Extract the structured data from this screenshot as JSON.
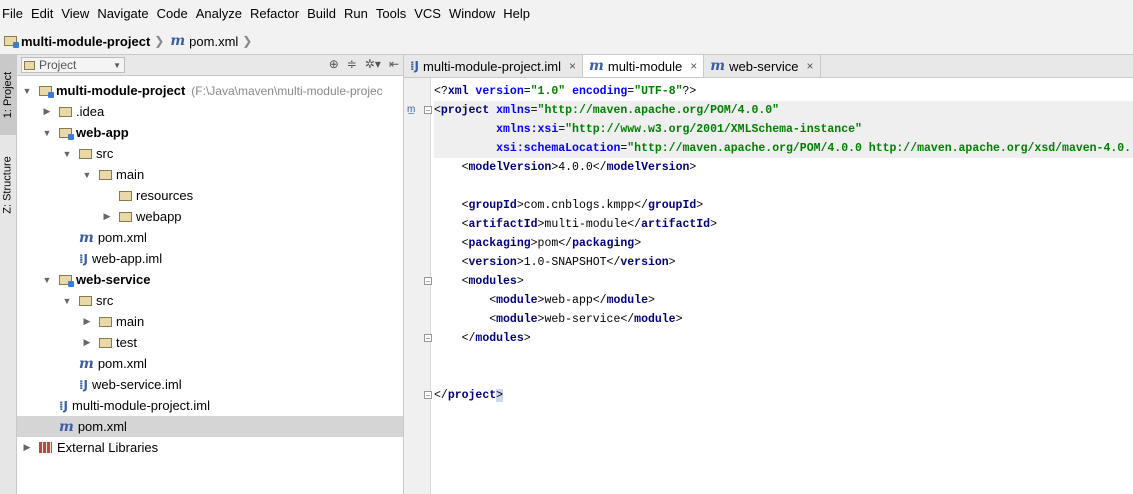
{
  "menubar": [
    "File",
    "Edit",
    "View",
    "Navigate",
    "Code",
    "Analyze",
    "Refactor",
    "Build",
    "Run",
    "Tools",
    "VCS",
    "Window",
    "Help"
  ],
  "breadcrumb": {
    "project": "multi-module-project",
    "file": "pom.xml"
  },
  "left_tool_tabs": {
    "project": "1: Project",
    "structure": "Z: Structure"
  },
  "project_panel": {
    "view_mode": "Project"
  },
  "tree": [
    {
      "label": "multi-module-project",
      "path": "(F:\\Java\\maven\\multi-module-projec",
      "indent": 0,
      "arrow": "▼",
      "icon": "proj-folder",
      "bold": true
    },
    {
      "label": ".idea",
      "indent": 1,
      "arrow": "▶",
      "icon": "folder"
    },
    {
      "label": "web-app",
      "indent": 1,
      "arrow": "▼",
      "icon": "proj-folder",
      "bold": true
    },
    {
      "label": "src",
      "indent": 2,
      "arrow": "▼",
      "icon": "folder"
    },
    {
      "label": "main",
      "indent": 3,
      "arrow": "▼",
      "icon": "folder"
    },
    {
      "label": "resources",
      "indent": 4,
      "arrow": "",
      "icon": "folder"
    },
    {
      "label": "webapp",
      "indent": 4,
      "arrow": "▶",
      "icon": "folder"
    },
    {
      "label": "pom.xml",
      "indent": 2,
      "arrow": "",
      "icon": "maven"
    },
    {
      "label": "web-app.iml",
      "indent": 2,
      "arrow": "",
      "icon": "iml"
    },
    {
      "label": "web-service",
      "indent": 1,
      "arrow": "▼",
      "icon": "proj-folder",
      "bold": true
    },
    {
      "label": "src",
      "indent": 2,
      "arrow": "▼",
      "icon": "folder"
    },
    {
      "label": "main",
      "indent": 3,
      "arrow": "▶",
      "icon": "folder"
    },
    {
      "label": "test",
      "indent": 3,
      "arrow": "▶",
      "icon": "folder"
    },
    {
      "label": "pom.xml",
      "indent": 2,
      "arrow": "",
      "icon": "maven"
    },
    {
      "label": "web-service.iml",
      "indent": 2,
      "arrow": "",
      "icon": "iml"
    },
    {
      "label": "multi-module-project.iml",
      "indent": 1,
      "arrow": "",
      "icon": "iml"
    },
    {
      "label": "pom.xml",
      "indent": 1,
      "arrow": "",
      "icon": "maven",
      "selected": true
    },
    {
      "label": "External Libraries",
      "indent": 0,
      "arrow": "▶",
      "icon": "library"
    }
  ],
  "tabs": [
    {
      "label": "multi-module-project.iml",
      "icon": "iml",
      "active": false
    },
    {
      "label": "multi-module",
      "icon": "maven",
      "active": true
    },
    {
      "label": "web-service",
      "icon": "maven",
      "active": false
    }
  ],
  "code_lines": [
    [
      [
        "plain",
        "<?"
      ],
      [
        "tagc",
        "xml "
      ],
      [
        "attr",
        "version"
      ],
      [
        "plain",
        "="
      ],
      [
        "val",
        "\"1.0\" "
      ],
      [
        "attr",
        "encoding"
      ],
      [
        "plain",
        "="
      ],
      [
        "val",
        "\"UTF-8\""
      ],
      [
        "plain",
        "?>"
      ]
    ],
    [
      [
        "plain",
        "<"
      ],
      [
        "tagc",
        "project "
      ],
      [
        "attr",
        "xmlns"
      ],
      [
        "plain",
        "="
      ],
      [
        "val",
        "\"http://maven.apache.org/POM/4.0.0\""
      ]
    ],
    [
      [
        "plain",
        "         "
      ],
      [
        "attr",
        "xmlns:xsi"
      ],
      [
        "plain",
        "="
      ],
      [
        "val",
        "\"http://www.w3.org/2001/XMLSchema-instance\""
      ]
    ],
    [
      [
        "plain",
        "         "
      ],
      [
        "attr",
        "xsi:schemaLocation"
      ],
      [
        "plain",
        "="
      ],
      [
        "val",
        "\"http://maven.apache.org/POM/4.0.0 http://maven.apache.org/xsd/maven-4.0."
      ]
    ],
    [
      [
        "plain",
        "    <"
      ],
      [
        "tagc",
        "modelVersion"
      ],
      [
        "plain",
        ">4.0.0</"
      ],
      [
        "tagc",
        "modelVersion"
      ],
      [
        "plain",
        ">"
      ]
    ],
    [
      [
        "plain",
        ""
      ]
    ],
    [
      [
        "plain",
        "    <"
      ],
      [
        "tagc",
        "groupId"
      ],
      [
        "plain",
        ">com.cnblogs.kmpp</"
      ],
      [
        "tagc",
        "groupId"
      ],
      [
        "plain",
        ">"
      ]
    ],
    [
      [
        "plain",
        "    <"
      ],
      [
        "tagc",
        "artifactId"
      ],
      [
        "plain",
        ">multi-module</"
      ],
      [
        "tagc",
        "artifactId"
      ],
      [
        "plain",
        ">"
      ]
    ],
    [
      [
        "plain",
        "    <"
      ],
      [
        "tagc",
        "packaging"
      ],
      [
        "plain",
        ">pom</"
      ],
      [
        "tagc",
        "packaging"
      ],
      [
        "plain",
        ">"
      ]
    ],
    [
      [
        "plain",
        "    <"
      ],
      [
        "tagc",
        "version"
      ],
      [
        "plain",
        ">1.0-SNAPSHOT</"
      ],
      [
        "tagc",
        "version"
      ],
      [
        "plain",
        ">"
      ]
    ],
    [
      [
        "plain",
        "    <"
      ],
      [
        "tagc",
        "modules"
      ],
      [
        "plain",
        ">"
      ]
    ],
    [
      [
        "plain",
        "        <"
      ],
      [
        "tagc",
        "module"
      ],
      [
        "plain",
        ">web-app</"
      ],
      [
        "tagc",
        "module"
      ],
      [
        "plain",
        ">"
      ]
    ],
    [
      [
        "plain",
        "        <"
      ],
      [
        "tagc",
        "module"
      ],
      [
        "plain",
        ">web-service</"
      ],
      [
        "tagc",
        "module"
      ],
      [
        "plain",
        ">"
      ]
    ],
    [
      [
        "plain",
        "    </"
      ],
      [
        "tagc",
        "modules"
      ],
      [
        "plain",
        ">"
      ]
    ],
    [
      [
        "plain",
        ""
      ]
    ],
    [
      [
        "plain",
        ""
      ]
    ],
    [
      [
        "plain",
        "</"
      ],
      [
        "tagc",
        "project"
      ],
      [
        "plain",
        ">"
      ]
    ]
  ]
}
